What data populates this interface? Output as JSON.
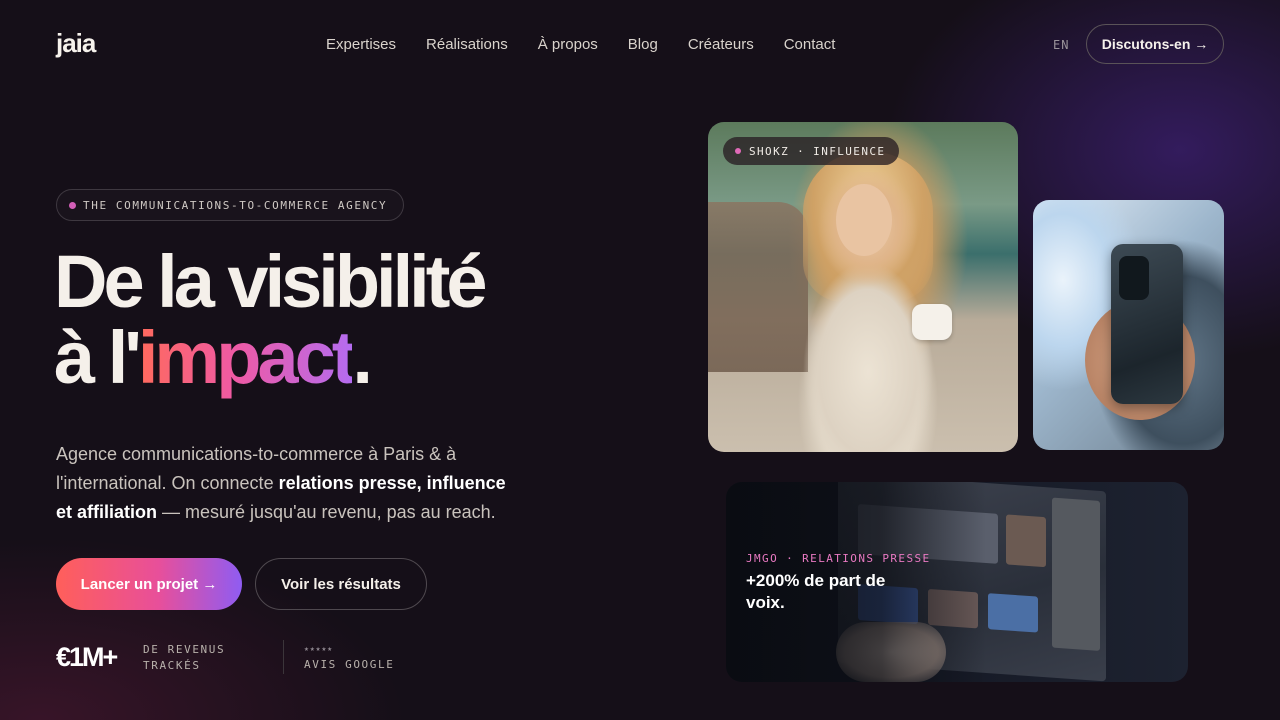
{
  "nav": {
    "logo": "jaia",
    "links": [
      "Expertises",
      "Réalisations",
      "À propos",
      "Blog",
      "Créateurs",
      "Contact"
    ],
    "lang": "EN",
    "cta": "Discutons-en →"
  },
  "hero": {
    "eyebrow": "THE COMMUNICATIONS-TO-COMMERCE AGENCY",
    "headline_line1": "De la visibilité",
    "headline_line2_prefix": "à l'",
    "headline_line2_accent": "impact",
    "headline_line2_suffix": ".",
    "subtitle_part1": "Agence communications-to-commerce à Paris & à l'international. On connecte ",
    "subtitle_bold": "relations presse, influence et affiliation",
    "subtitle_part2": " — mesuré jusqu'au revenu, pas au reach.",
    "primary_cta": "Lancer un projet →",
    "secondary_cta": "Voir les résultats"
  },
  "stats": {
    "revenue_value": "€1M+",
    "revenue_label": "DE REVENUS TRACKÉS",
    "stars": "★★★★★",
    "reviews_label": "AVIS GOOGLE"
  },
  "cards": {
    "card1_tag": "SHOKZ · INFLUENCE",
    "card3_tag": "JMGO · RELATIONS PRESSE",
    "card3_title": "+200% de part de voix."
  },
  "colors": {
    "background": "#150f18",
    "accent_start": "#ff5f5a",
    "accent_mid": "#e84f9a",
    "accent_end": "#8f5cf2",
    "tag_pink": "#e979c2"
  },
  "icons": {
    "dot": "status-dot-icon",
    "arrow": "arrow-right-icon"
  }
}
